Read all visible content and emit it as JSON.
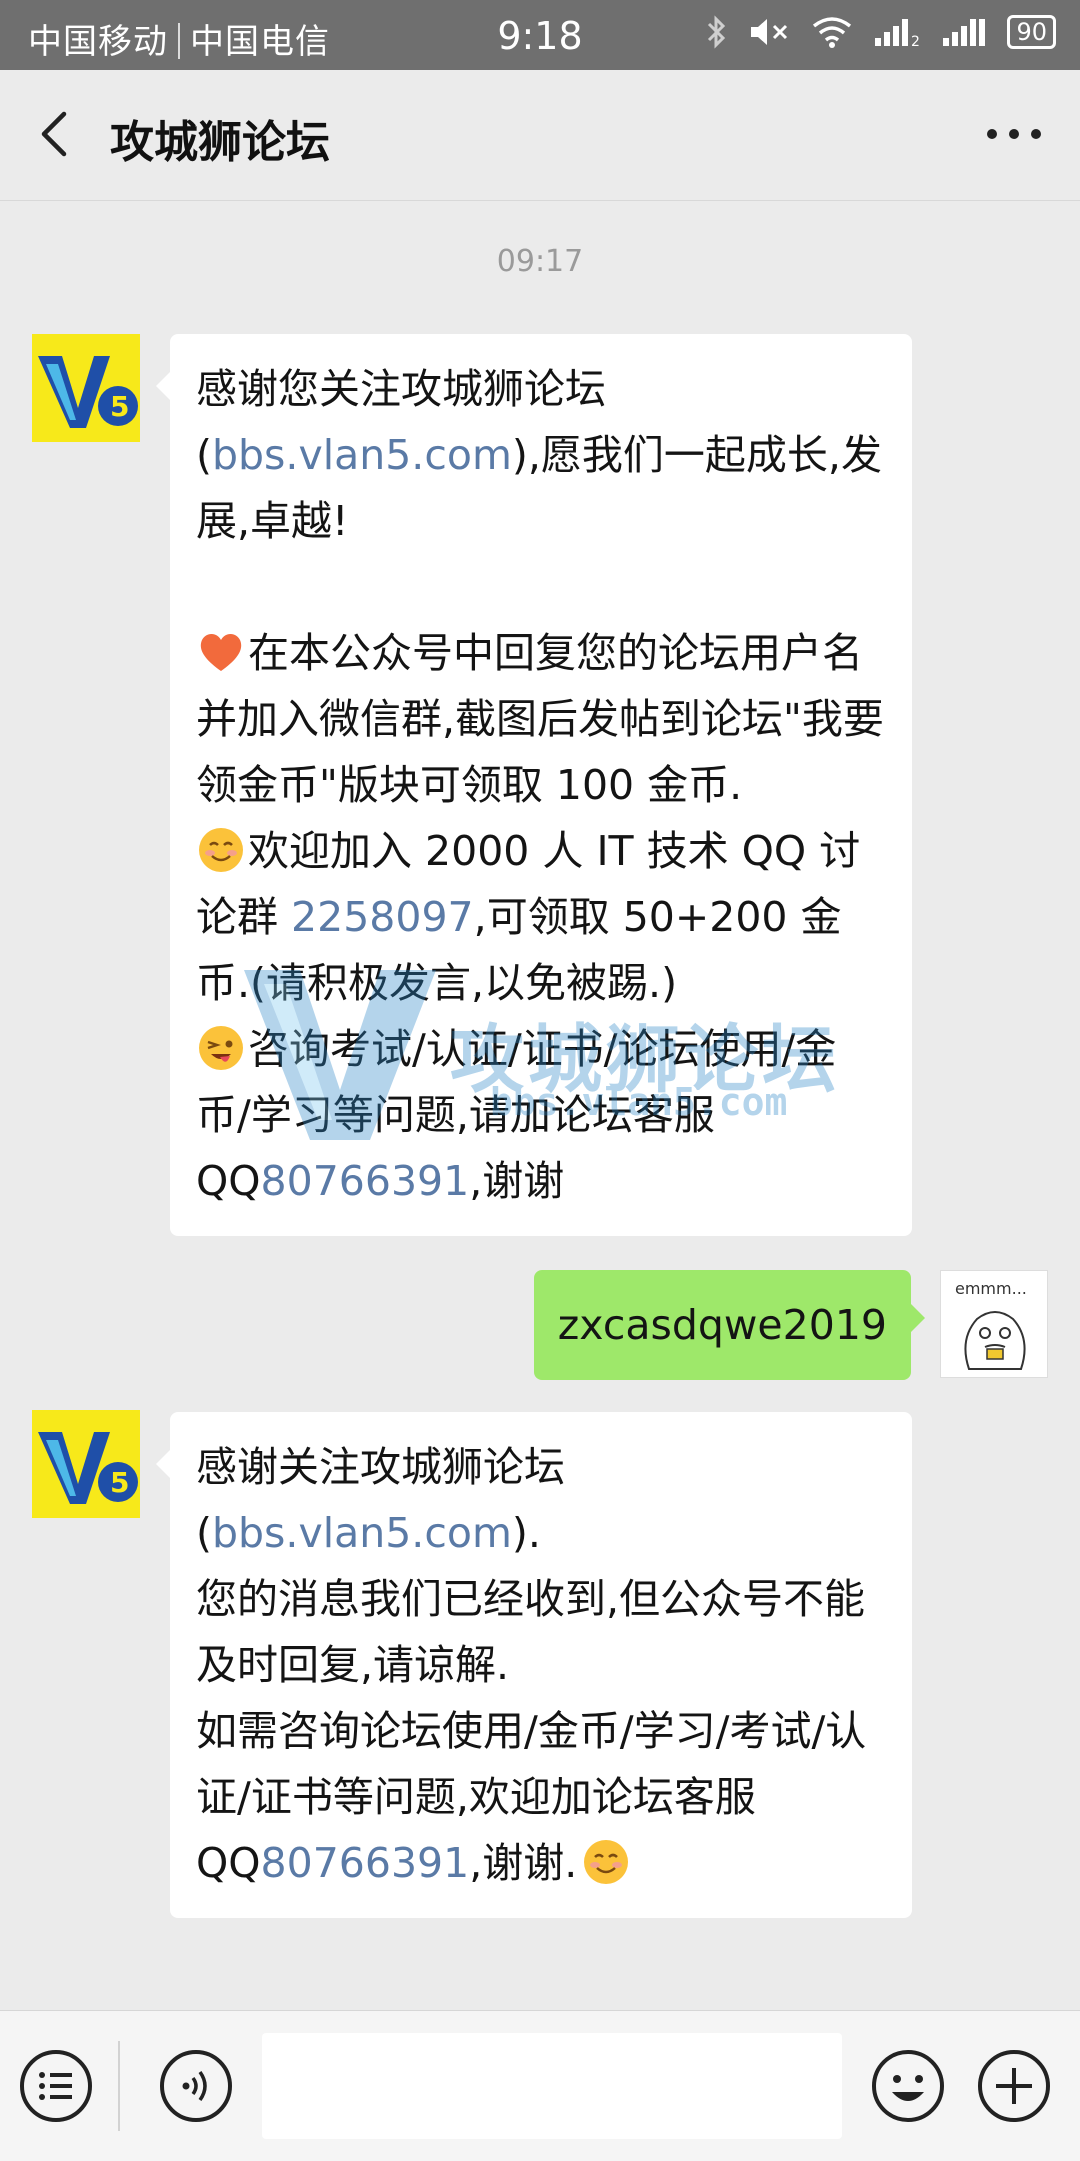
{
  "status_bar": {
    "carrier1": "中国移动",
    "carrier2": "中国电信",
    "time": "9:18",
    "battery": "90"
  },
  "header": {
    "title": "攻城狮论坛"
  },
  "chat": {
    "timestamp": "09:17",
    "msg1": {
      "l1a": "感谢您关注攻城狮论坛(",
      "l1b": "bbs.vlan5.com",
      "l1c": "),愿我们一起成长,发展,卓越!",
      "p2": "在本公众号中回复您的论坛用户名并加入微信群,截图后发帖到论坛\"我要领金币\"版块可领取 100 金币.",
      "p3a": "欢迎加入 2000 人 IT 技术 QQ 讨论群 ",
      "p3b": "2258097",
      "p3c": ",可领取 50+200 金币.(请积极发言,以免被踢.)",
      "p4a": "咨询考试/认证/证书/论坛使用/金币/学习等问题,请加论坛客服 QQ",
      "p4b": "80766391",
      "p4c": ",谢谢"
    },
    "msg_out": {
      "text": "zxcasdqwe2019",
      "avatar_caption": "emmm..."
    },
    "msg2": {
      "l1a": "感谢关注攻城狮论坛(",
      "l1b": "bbs.vlan5.com",
      "l1c": ").",
      "l2": "您的消息我们已经收到,但公众号不能及时回复,请谅解.",
      "l3a": "如需咨询论坛使用/金币/学习/考试/认证/证书等问题,欢迎加论坛客服 QQ",
      "l3b": "80766391",
      "l3c": ",谢谢."
    }
  },
  "watermark": {
    "title": "攻城狮论坛",
    "url": "bbs.vlan5.com"
  },
  "colors": {
    "link": "#5a7aa6",
    "outgoing_bubble": "#9ee86a",
    "avatar_bg": "#f7e91a"
  }
}
